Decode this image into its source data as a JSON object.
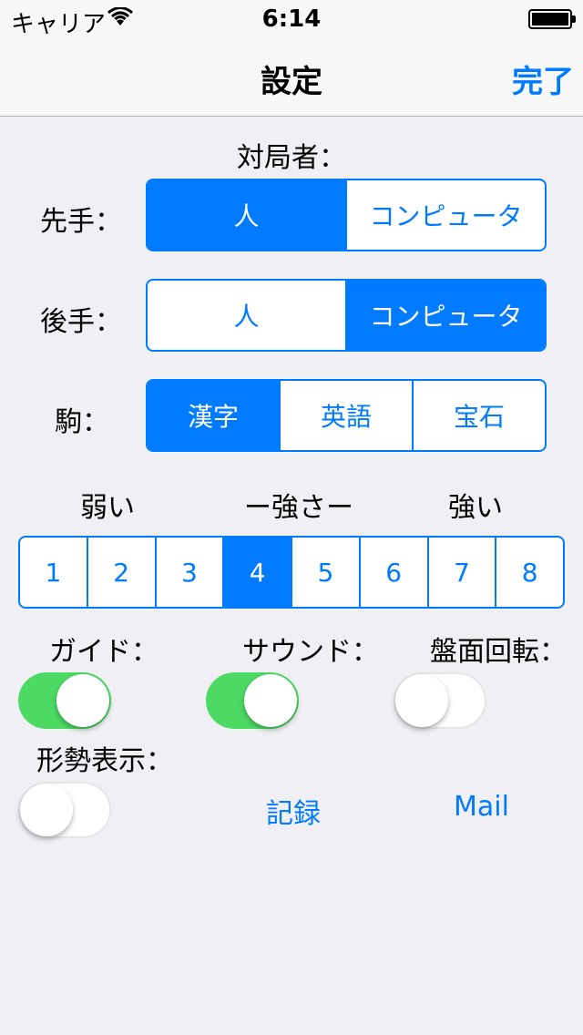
{
  "status_bar": {
    "carrier": "キャリア",
    "time": "6:14"
  },
  "nav": {
    "title": "設定",
    "done": "完了"
  },
  "players": {
    "header": "対局者：",
    "first_label": "先手：",
    "first_options": [
      "人",
      "コンピュータ"
    ],
    "first_selected": 0,
    "second_label": "後手：",
    "second_options": [
      "人",
      "コンピュータ"
    ],
    "second_selected": 1
  },
  "pieces": {
    "label": "駒：",
    "options": [
      "漢字",
      "英語",
      "宝石"
    ],
    "selected": 0
  },
  "strength": {
    "weak": "弱い",
    "title": "ー強さー",
    "strong": "強い",
    "levels": [
      "1",
      "2",
      "3",
      "4",
      "5",
      "6",
      "7",
      "8"
    ],
    "selected": 3
  },
  "toggles": {
    "guide_label": "ガイド：",
    "guide_on": true,
    "sound_label": "サウンド：",
    "sound_on": true,
    "rotate_label": "盤面回転：",
    "rotate_on": false,
    "eval_label": "形勢表示：",
    "eval_on": false
  },
  "links": {
    "record": "記録",
    "mail": "Mail"
  },
  "colors": {
    "accent": "#007aff",
    "switch_on": "#4cd964",
    "background": "#efeff4"
  }
}
